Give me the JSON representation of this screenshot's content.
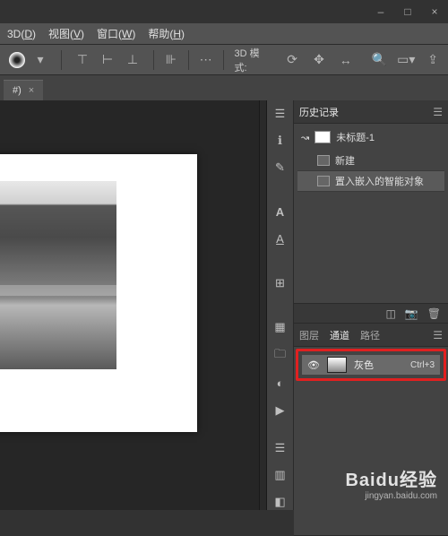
{
  "window": {
    "min": "–",
    "max": "□",
    "close": "×"
  },
  "menu": {
    "item3d": "3D(<u>D</u>)",
    "view": "视图(<u>V</u>)",
    "window": "窗口(<u>W</u>)",
    "help": "帮助(<u>H</u>)"
  },
  "options": {
    "mode_label": "3D 模式:"
  },
  "doctab": {
    "title": "#)",
    "close": "×"
  },
  "history": {
    "tab": "历史记录",
    "doc": "未标题-1",
    "steps": [
      "新建",
      "置入嵌入的智能对象"
    ]
  },
  "channels": {
    "tabs": {
      "layers": "图层",
      "channels": "通道",
      "paths": "路径"
    },
    "gray": "灰色",
    "shortcut": "Ctrl+3"
  },
  "watermark": {
    "main": "Baidu经验",
    "sub": "jingyan.baidu.com"
  }
}
